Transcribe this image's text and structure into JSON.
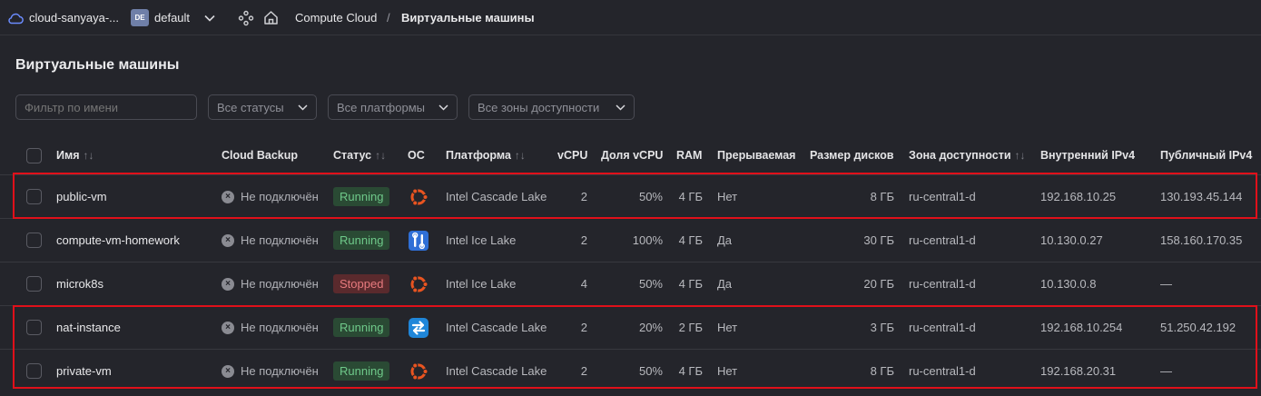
{
  "topbar": {
    "cloud_name": "cloud-sanyaya-...",
    "folder_badge": "DE",
    "folder_name": "default",
    "breadcrumb_service": "Compute Cloud",
    "breadcrumb_sep": "/",
    "breadcrumb_page": "Виртуальные машины"
  },
  "page": {
    "title": "Виртуальные машины"
  },
  "filters": {
    "name_placeholder": "Фильтр по имени",
    "status": "Все статусы",
    "platform": "Все платформы",
    "zone": "Все зоны доступности"
  },
  "table": {
    "headers": {
      "name": "Имя",
      "backup": "Cloud Backup",
      "status": "Статус",
      "os": "ОС",
      "platform": "Платформа",
      "vcpu": "vCPU",
      "share": "Доля vCPU",
      "ram": "RAM",
      "preempt": "Прерываемая",
      "disk": "Размер дисков",
      "zone": "Зона доступности",
      "ipv4_int": "Внутренний IPv4",
      "ipv4_pub": "Публичный IPv4"
    },
    "sort_glyph": "↑↓",
    "rows": [
      {
        "name": "public-vm",
        "backup": "Не подключён",
        "status": "Running",
        "status_kind": "running",
        "os": "ubuntu-icon",
        "platform": "Intel Cascade Lake",
        "vcpu": "2",
        "share": "50%",
        "ram": "4 ГБ",
        "preempt": "Нет",
        "disk": "8 ГБ",
        "zone": "ru-central1-d",
        "ipv4_int": "192.168.10.25",
        "ipv4_pub": "130.193.45.144"
      },
      {
        "name": "compute-vm-homework",
        "backup": "Не подключён",
        "status": "Running",
        "status_kind": "running",
        "os": "tools-icon",
        "platform": "Intel Ice Lake",
        "vcpu": "2",
        "share": "100%",
        "ram": "4 ГБ",
        "preempt": "Да",
        "disk": "30 ГБ",
        "zone": "ru-central1-d",
        "ipv4_int": "10.130.0.27",
        "ipv4_pub": "158.160.170.35"
      },
      {
        "name": "microk8s",
        "backup": "Не подключён",
        "status": "Stopped",
        "status_kind": "stopped",
        "os": "ubuntu-icon",
        "platform": "Intel Ice Lake",
        "vcpu": "4",
        "share": "50%",
        "ram": "4 ГБ",
        "preempt": "Да",
        "disk": "20 ГБ",
        "zone": "ru-central1-d",
        "ipv4_int": "10.130.0.8",
        "ipv4_pub": "—"
      },
      {
        "name": "nat-instance",
        "backup": "Не подключён",
        "status": "Running",
        "status_kind": "running",
        "os": "nat-icon",
        "platform": "Intel Cascade Lake",
        "vcpu": "2",
        "share": "20%",
        "ram": "2 ГБ",
        "preempt": "Нет",
        "disk": "3 ГБ",
        "zone": "ru-central1-d",
        "ipv4_int": "192.168.10.254",
        "ipv4_pub": "51.250.42.192"
      },
      {
        "name": "private-vm",
        "backup": "Не подключён",
        "status": "Running",
        "status_kind": "running",
        "os": "ubuntu-icon",
        "platform": "Intel Cascade Lake",
        "vcpu": "2",
        "share": "50%",
        "ram": "4 ГБ",
        "preempt": "Нет",
        "disk": "8 ГБ",
        "zone": "ru-central1-d",
        "ipv4_int": "192.168.20.31",
        "ipv4_pub": "—"
      }
    ]
  },
  "colors": {
    "background": "#24252b",
    "running_bg": "#2a4a34",
    "running_text": "#6fc98a",
    "stopped_bg": "#5a2a2d",
    "stopped_text": "#e77a7e",
    "highlight": "#e0101a",
    "ubuntu": "#e95420"
  }
}
